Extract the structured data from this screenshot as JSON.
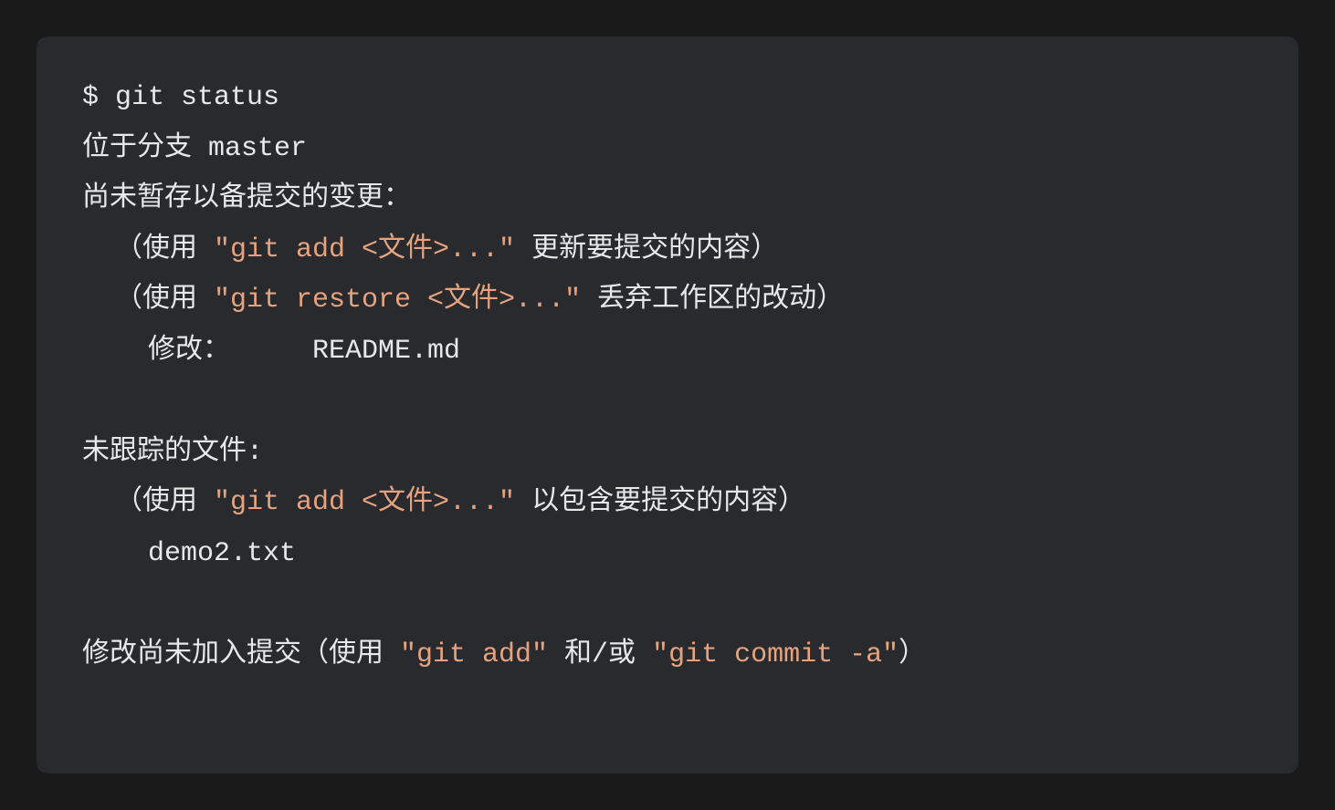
{
  "terminal": {
    "prompt": "$ ",
    "command": "git status",
    "output": {
      "branch_line": "位于分支 master",
      "unstaged_header": "尚未暂存以备提交的变更：",
      "hint1_prefix": "  （使用 ",
      "hint1_code": "\"git add <文件>...\"",
      "hint1_suffix": " 更新要提交的内容）",
      "hint2_prefix": "  （使用 ",
      "hint2_code": "\"git restore <文件>...\"",
      "hint2_suffix": " 丢弃工作区的改动）",
      "modified_label": "    修改：     ",
      "modified_file": "README.md",
      "untracked_header": "未跟踪的文件:",
      "hint3_prefix": "  （使用 ",
      "hint3_code": "\"git add <文件>...\"",
      "hint3_suffix": " 以包含要提交的内容）",
      "untracked_file": "    demo2.txt",
      "final_prefix": "修改尚未加入提交（使用 ",
      "final_code1": "\"git add\"",
      "final_mid": " 和/或 ",
      "final_code2": "\"git commit -a\"",
      "final_suffix": "）"
    }
  }
}
